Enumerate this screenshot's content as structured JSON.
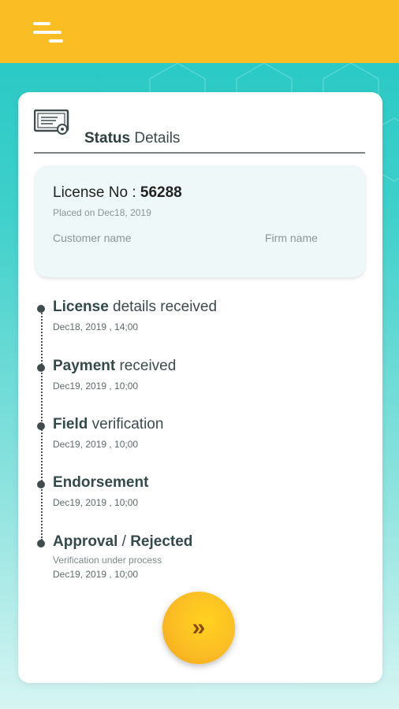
{
  "header": {
    "menu_icon": "menu-icon",
    "background": "#fbbd24"
  },
  "card": {
    "title_bold": "Status",
    "title_rest": " Details",
    "icon": "certificate-icon"
  },
  "license": {
    "label": "License No : ",
    "number": "56288",
    "placed_on": "Placed on Dec18, 2019",
    "customer_label": "Customer name",
    "firm_label": "Firm name"
  },
  "timeline": [
    {
      "bold": "License",
      "rest": " details received",
      "date": "Dec18, 2019 , 14;00"
    },
    {
      "bold": "Payment",
      "rest": " received",
      "date": "Dec19, 2019 , 10;00"
    },
    {
      "bold": "Field",
      "rest": " verification",
      "date": "Dec19, 2019 , 10;00"
    },
    {
      "bold": "Endorsement",
      "rest": "",
      "date": "Dec19, 2019 , 10;00"
    },
    {
      "bold": "Approval",
      "rest": " / ",
      "bold2": "Rejected",
      "sub": "Verification under process",
      "date": "Dec19, 2019 , 10;00"
    }
  ],
  "next_button": {
    "label": "»",
    "icon": "double-chevron-right-icon"
  },
  "colors": {
    "accent": "#fbbd24",
    "teal": "#22c7c3",
    "text_dark": "#3c4a4b"
  }
}
